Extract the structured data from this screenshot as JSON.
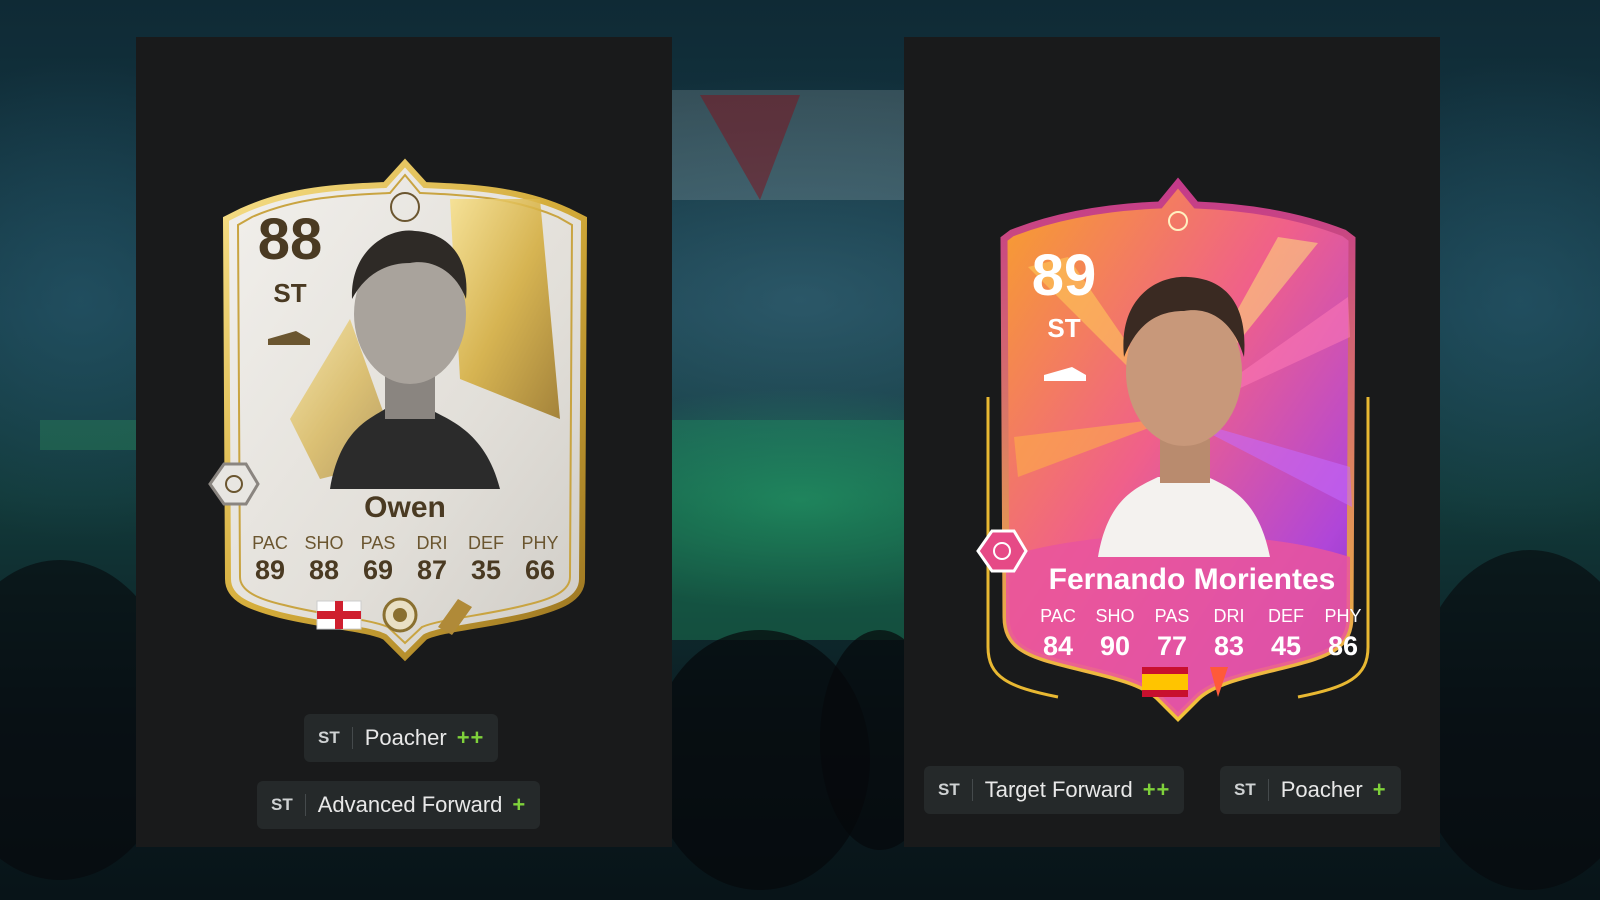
{
  "cards": [
    {
      "rating": "88",
      "position": "ST",
      "name": "Owen",
      "stats": [
        {
          "label": "PAC",
          "value": "89"
        },
        {
          "label": "SHO",
          "value": "88"
        },
        {
          "label": "PAS",
          "value": "69"
        },
        {
          "label": "DRI",
          "value": "87"
        },
        {
          "label": "DEF",
          "value": "35"
        },
        {
          "label": "PHY",
          "value": "66"
        }
      ],
      "nation_flag": "england-flag-icon",
      "club_badge": "icons-badge-icon",
      "league_badge": "league-badge-icon",
      "card_colors": {
        "gold": "#c9a441",
        "text": "#4a3a22",
        "bg": "#e9e7e2"
      },
      "playstyles": [
        {
          "position": "ST",
          "name": "Poacher",
          "plus": "++"
        },
        {
          "position": "ST",
          "name": "Advanced Forward",
          "plus": "+"
        }
      ]
    },
    {
      "rating": "89",
      "position": "ST",
      "name": "Fernando Morientes",
      "stats": [
        {
          "label": "PAC",
          "value": "84"
        },
        {
          "label": "SHO",
          "value": "90"
        },
        {
          "label": "PAS",
          "value": "77"
        },
        {
          "label": "DRI",
          "value": "83"
        },
        {
          "label": "DEF",
          "value": "45"
        },
        {
          "label": "PHY",
          "value": "86"
        }
      ],
      "nation_flag": "spain-flag-icon",
      "league_badge": "laliga-badge-icon",
      "card_colors": {
        "orange": "#f58a1f",
        "pink": "#ec4a9a",
        "purple": "#8a3fd1",
        "text": "#ffffff"
      },
      "playstyles": [
        {
          "position": "ST",
          "name": "Target Forward",
          "plus": "++"
        },
        {
          "position": "ST",
          "name": "Poacher",
          "plus": "+"
        }
      ]
    }
  ],
  "accent_plus_color": "#7fd13b"
}
